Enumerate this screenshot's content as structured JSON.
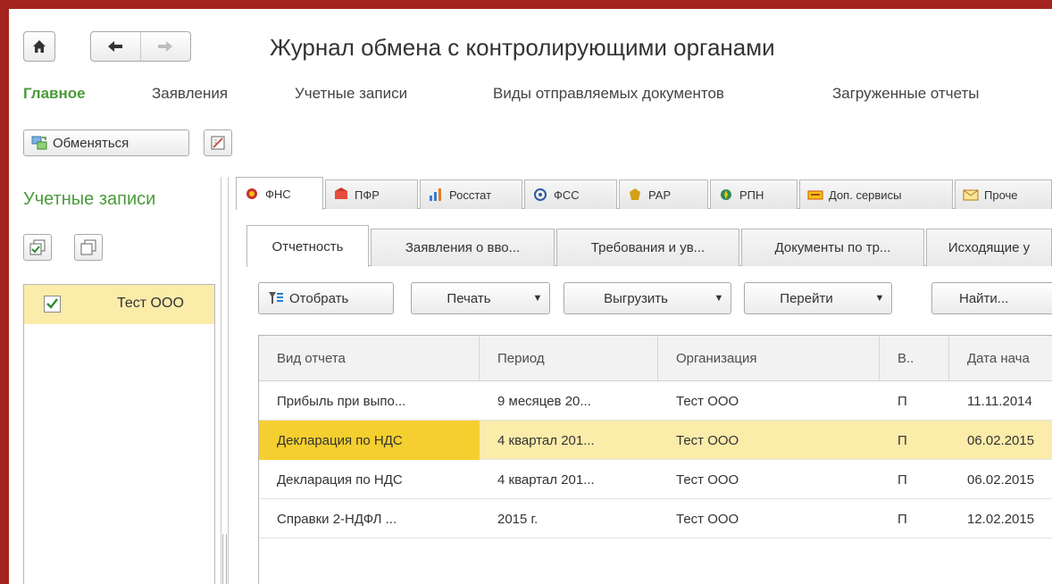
{
  "window": {
    "title": "Журнал обмена с контролирующими органами"
  },
  "nav": {
    "home_icon": "home-icon",
    "back_icon": "arrow-left-icon",
    "forward_icon": "arrow-right-icon"
  },
  "sections": [
    {
      "label": "Главное",
      "active": true
    },
    {
      "label": "Заявления",
      "active": false
    },
    {
      "label": "Учетные записи",
      "active": false
    },
    {
      "label": "Виды отправляемых документов",
      "active": false
    },
    {
      "label": "Загруженные отчеты",
      "active": false
    }
  ],
  "commands": {
    "exchange_label": "Обменяться"
  },
  "sidebar": {
    "title": "Учетные записи",
    "items": [
      {
        "label": "Тест ООО",
        "checked": true
      }
    ]
  },
  "agency_tabs": [
    {
      "label": "ФНС",
      "icon": "fns-emblem-icon",
      "active": true
    },
    {
      "label": "ПФР",
      "icon": "pfr-icon",
      "active": false
    },
    {
      "label": "Росстат",
      "icon": "rosstat-chart-icon",
      "active": false
    },
    {
      "label": "ФСС",
      "icon": "fss-icon",
      "active": false
    },
    {
      "label": "РАР",
      "icon": "rar-emblem-icon",
      "active": false
    },
    {
      "label": "РПН",
      "icon": "rpn-emblem-icon",
      "active": false
    },
    {
      "label": "Доп. сервисы",
      "icon": "services-icon",
      "active": false
    },
    {
      "label": "Проче",
      "icon": "envelope-icon",
      "active": false
    }
  ],
  "report_tabs": [
    {
      "label": "Отчетность",
      "active": true
    },
    {
      "label": "Заявления о вво...",
      "active": false
    },
    {
      "label": "Требования и ув...",
      "active": false
    },
    {
      "label": "Документы по тр...",
      "active": false
    },
    {
      "label": "Исходящие у",
      "active": false
    }
  ],
  "toolbar": {
    "filter_label": "Отобрать",
    "print_label": "Печать",
    "export_label": "Выгрузить",
    "goto_label": "Перейти",
    "find_label": "Найти..."
  },
  "table": {
    "columns": [
      "Вид отчета",
      "Период",
      "Организация",
      "В..",
      "Дата нача"
    ],
    "rows": [
      [
        "Прибыль при выпо...",
        "9 месяцев 20...",
        "Тест ООО",
        "П",
        "11.11.2014"
      ],
      [
        "Декларация по НДС",
        "4 квартал 201...",
        "Тест ООО",
        "П",
        "06.02.2015"
      ],
      [
        "Декларация по НДС",
        "4 квартал 201...",
        "Тест ООО",
        "П",
        "06.02.2015"
      ],
      [
        "Справки 2-НДФЛ ...",
        "2015 г.",
        "Тест ООО",
        "П",
        "12.02.2015"
      ]
    ],
    "selected_row": 1
  },
  "colors": {
    "frame": "#a3241f",
    "accent_green": "#4a9a3b",
    "selection": "#fbecaa",
    "focus_cell": "#f5cf2f"
  }
}
